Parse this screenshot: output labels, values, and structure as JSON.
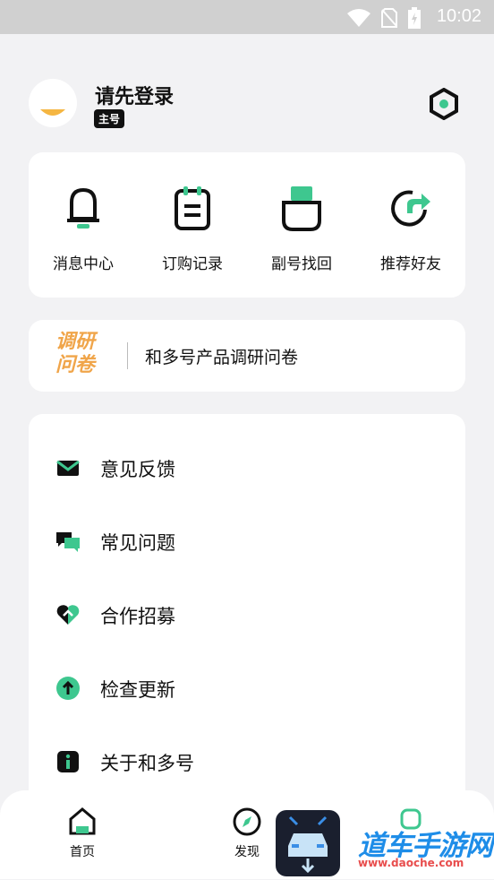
{
  "status_bar": {
    "time": "10:02"
  },
  "profile": {
    "login_text": "请先登录",
    "badge": "主号"
  },
  "quick_actions": [
    {
      "label": "消息中心",
      "icon": "bell-icon"
    },
    {
      "label": "订购记录",
      "icon": "notepad-icon"
    },
    {
      "label": "副号找回",
      "icon": "sim-card-icon"
    },
    {
      "label": "推荐好友",
      "icon": "share-icon"
    }
  ],
  "survey": {
    "logo_line1": "调研",
    "logo_line2": "问卷",
    "text": "和多号产品调研问卷"
  },
  "menu": [
    {
      "label": "意见反馈",
      "icon": "mail-icon"
    },
    {
      "label": "常见问题",
      "icon": "chat-icon"
    },
    {
      "label": "合作招募",
      "icon": "heart-icon"
    },
    {
      "label": "检查更新",
      "icon": "update-arrow-icon"
    },
    {
      "label": "关于和多号",
      "icon": "info-icon"
    }
  ],
  "tabbar": {
    "home": "首页",
    "discover": "发现"
  },
  "watermark": {
    "main": "道车手游网",
    "sub": "www.daoche.com"
  },
  "colors": {
    "accent": "#3ec78f",
    "survey_orange": "#f0a54a",
    "status_bar": "#d0d0d0"
  }
}
